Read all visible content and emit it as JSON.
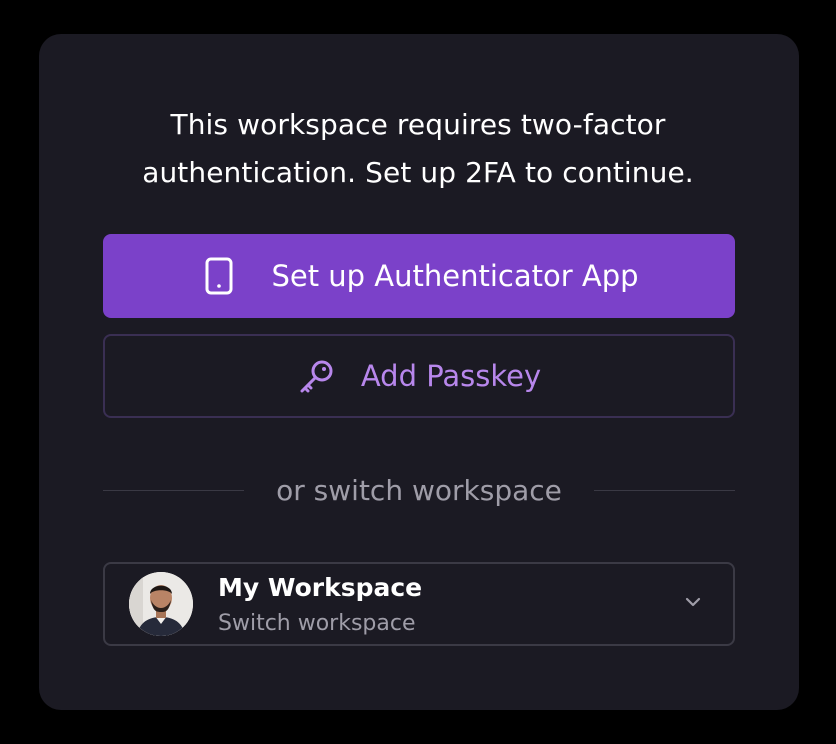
{
  "message": {
    "line1": "This workspace requires two-factor",
    "line2": "authentication. Set up 2FA to continue."
  },
  "buttons": {
    "authenticator": {
      "label": "Set up Authenticator App",
      "icon": "smartphone-icon"
    },
    "passkey": {
      "label": "Add Passkey",
      "icon": "key-icon"
    }
  },
  "divider": {
    "text": "or switch workspace"
  },
  "workspace": {
    "name": "My Workspace",
    "subtitle": "Switch workspace",
    "avatar": "user-avatar",
    "dropdown_icon": "chevron-down-icon"
  },
  "colors": {
    "background": "#000000",
    "card": "#1b1a23",
    "primary": "#7b41c9",
    "accent_text": "#b887ec",
    "muted_text": "#9f9da8"
  }
}
